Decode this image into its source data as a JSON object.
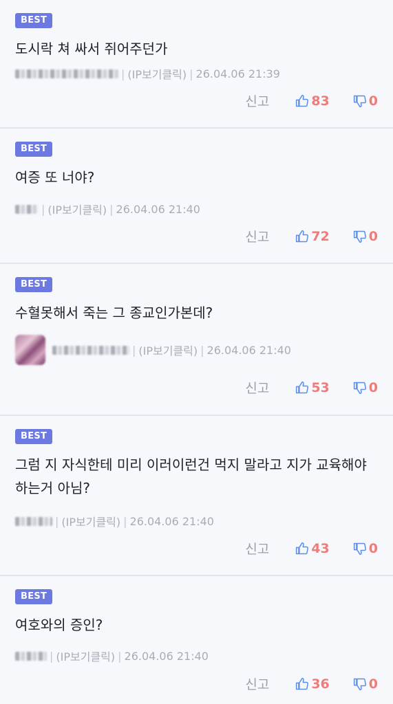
{
  "best_label": "BEST",
  "report_label": "신고",
  "colors": {
    "badge": "#6c79e0",
    "vote_count": "#f07b78",
    "thumb_icon": "#5b8de6"
  },
  "comments": [
    {
      "text": "도시락 쳐 싸서 쥐어주던가",
      "ip": "(IP보기클릭)",
      "date": "26.04.06 21:39",
      "up": "83",
      "down": "0"
    },
    {
      "text": "여증 또 너야?",
      "ip": "(IP보기클릭)",
      "date": "26.04.06 21:40",
      "up": "72",
      "down": "0"
    },
    {
      "text": "수혈못해서 죽는 그 종교인가본데?",
      "ip": "(IP보기클릭)",
      "date": "26.04.06 21:40",
      "up": "53",
      "down": "0"
    },
    {
      "text": "그럼 지 자식한테 미리 이러이런건 먹지 말라고 지가 교육해야 하는거 아님?",
      "ip": "(IP보기클릭)",
      "date": "26.04.06 21:40",
      "up": "43",
      "down": "0"
    },
    {
      "text": "여호와의 증인?",
      "ip": "(IP보기클릭)",
      "date": "26.04.06 21:40",
      "up": "36",
      "down": "0"
    }
  ]
}
